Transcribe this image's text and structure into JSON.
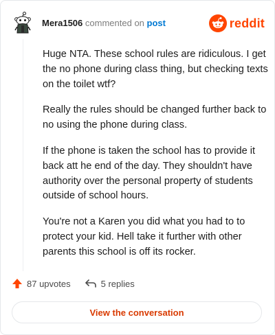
{
  "header": {
    "username": "Mera1506",
    "action_text": "commented on",
    "post_link": "post",
    "brand": "reddit",
    "avatar_icon": "snoo-avatar-icon",
    "brand_icon": "reddit-logo-icon"
  },
  "comment": {
    "paragraphs": [
      "Huge NTA. These school rules are ridiculous. I get the no phone during class thing, but checking texts on the toilet wtf?",
      "Really the rules should be changed further back to no using the phone during class.",
      "If the phone is taken the school has to provide it back att he end of the day. They shouldn't have authority over the personal property of students outside of school hours.",
      "You're not a Karen you did what you had to to protect your kid. Hell take it further with other parents this school is off its rocker."
    ]
  },
  "footer": {
    "upvotes": "87 upvotes",
    "replies": "5 replies",
    "upvote_icon": "upvote-arrow-icon",
    "reply_icon": "reply-arrow-icon"
  },
  "cta": {
    "label": "View the conversation"
  },
  "colors": {
    "brand": "#ff4500",
    "link": "#0079d3",
    "cta_text": "#d93a00",
    "border": "#e5e7ea"
  }
}
